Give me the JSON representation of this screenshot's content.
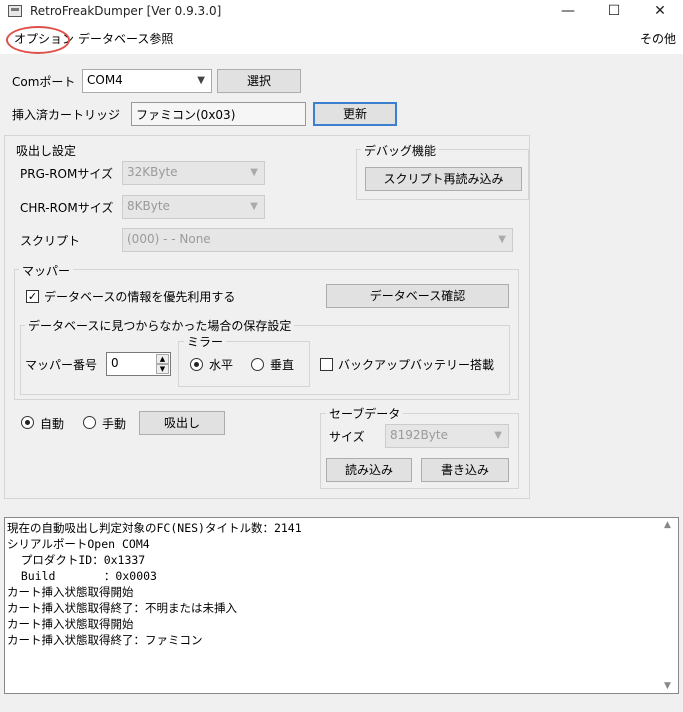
{
  "window": {
    "title": "RetroFreakDumper [Ver 0.9.3.0]",
    "minimize": "—",
    "maximize": "☐",
    "close": "✕"
  },
  "menu": {
    "option": "オプション",
    "database": "データベース参照",
    "other": "その他"
  },
  "com": {
    "label": "Comポート",
    "value": "COM4",
    "select_button": "選択"
  },
  "cartridge": {
    "label": "挿入済カートリッジ",
    "value": "ファミコン(0x03)",
    "update_button": "更新"
  },
  "extract": {
    "group_title": "吸出し設定",
    "prg_label": "PRG-ROMサイズ",
    "prg_value": "32KByte",
    "chr_label": "CHR-ROMサイズ",
    "chr_value": "8KByte",
    "script_label": "スクリプト",
    "script_value": "(000) - - None"
  },
  "debug": {
    "group_title": "デバッグ機能",
    "reload_button": "スクリプト再読み込み"
  },
  "mapper": {
    "group_title": "マッパー",
    "use_db_label": "データベースの情報を優先利用する",
    "use_db_checked": true,
    "db_check_button": "データベース確認",
    "notfound_group_title": "データベースに見つからなかった場合の保存設定",
    "number_label": "マッパー番号",
    "number_value": "0",
    "mirror_title": "ミラー",
    "horizontal_label": "水平",
    "vertical_label": "垂直",
    "backup_label": "バックアップバッテリー搭載"
  },
  "mode": {
    "auto_label": "自動",
    "manual_label": "手動",
    "extract_button": "吸出し"
  },
  "save": {
    "group_title": "セーブデータ",
    "size_label": "サイズ",
    "size_value": "8192Byte",
    "read_button": "読み込み",
    "write_button": "書き込み"
  },
  "log": {
    "lines": [
      "現在の自動吸出し判定対象のFC(NES)タイトル数：2141",
      "シリアルポートOpen COM4",
      "  プロダクトID：0x1337",
      "  Build       ：0x0003",
      "カート挿入状態取得開始",
      "カート挿入状態取得終了：不明または未挿入",
      "カート挿入状態取得開始",
      "カート挿入状態取得終了：ファミコン"
    ]
  },
  "colors": {
    "highlight_circle": "#e0504a",
    "focus_border": "#3c7fcf"
  }
}
